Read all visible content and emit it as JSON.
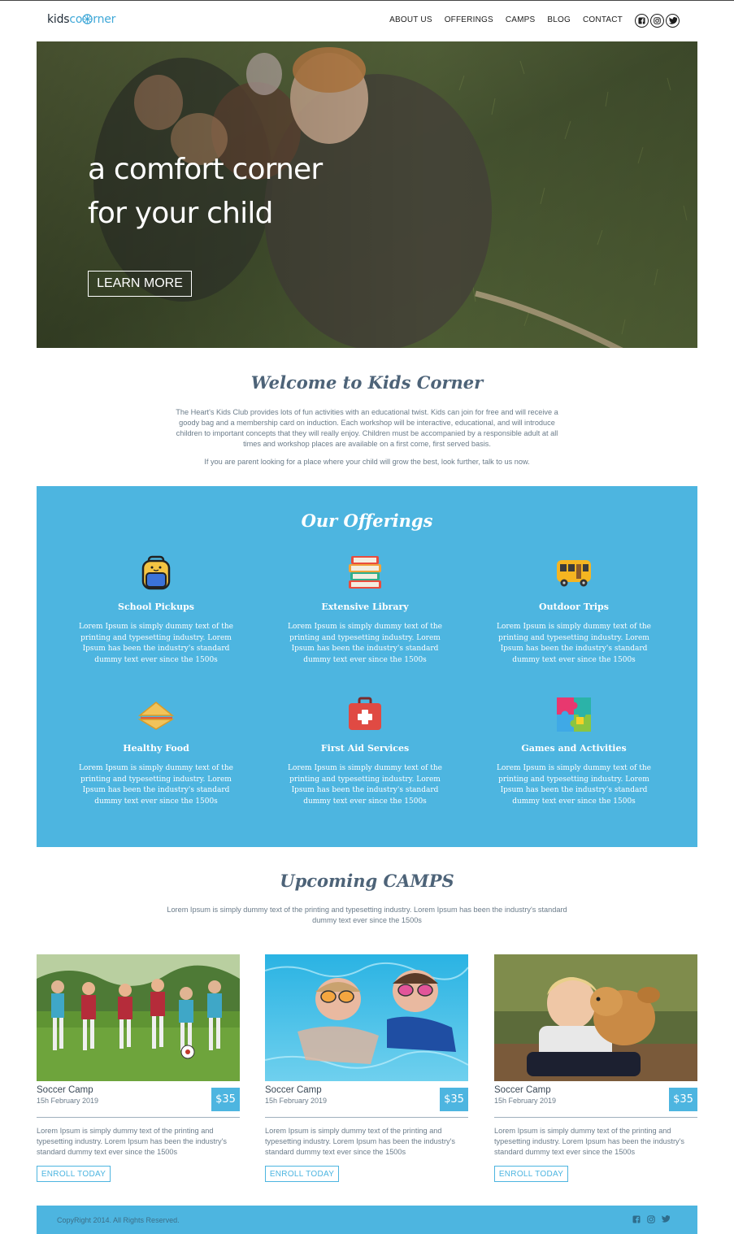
{
  "header": {
    "logo_prefix": "kids",
    "logo_accent": "rner",
    "nav": [
      "ABOUT US",
      "OFFERINGS",
      "CAMPS",
      "BLOG",
      "CONTACT"
    ],
    "social": [
      "facebook-icon",
      "instagram-icon",
      "twitter-icon"
    ]
  },
  "hero": {
    "line1": "a comfort corner",
    "line2": "for your child",
    "cta": "LEARN MORE"
  },
  "welcome": {
    "title": "Welcome to Kids Corner",
    "paragraph": "The Heart's Kids Club provides lots of fun activities with an educational twist. Kids can join for free and will receive a goody bag and a membership card on induction. Each workshop will be interactive, educational, and will introduce children to important concepts that they will really enjoy. Children must be accompanied by a responsible adult at all times and workshop places are available on a first come, first served basis.",
    "paragraph2": "If you are parent looking for a place where your child will grow the best, look further, talk to us now."
  },
  "offerings": {
    "title": "Our Offerings",
    "items": [
      {
        "title": "School Pickups",
        "icon": "backpack-icon",
        "text": "Lorem Ipsum is simply dummy text of the printing and typesetting industry. Lorem Ipsum has been the industry's standard dummy text ever since the 1500s"
      },
      {
        "title": "Extensive Library",
        "icon": "books-icon",
        "text": "Lorem Ipsum is simply dummy text of the printing and typesetting industry. Lorem Ipsum has been the industry's standard dummy text ever since the 1500s"
      },
      {
        "title": "Outdoor Trips",
        "icon": "bus-icon",
        "text": "Lorem Ipsum is simply dummy text of the printing and typesetting industry. Lorem Ipsum has been the industry's standard dummy text ever since the 1500s"
      },
      {
        "title": "Healthy Food",
        "icon": "sandwich-icon",
        "text": "Lorem Ipsum is simply dummy text of the printing and typesetting industry. Lorem Ipsum has been the industry's standard dummy text ever since the 1500s"
      },
      {
        "title": "First Aid Services",
        "icon": "first-aid-kit-icon",
        "text": "Lorem Ipsum is simply dummy text of the printing and typesetting industry. Lorem Ipsum has been the industry's standard dummy text ever since the 1500s"
      },
      {
        "title": "Games and Activities",
        "icon": "puzzle-icon",
        "text": "Lorem Ipsum is simply dummy text of the printing and typesetting industry. Lorem Ipsum has been the industry's standard dummy text ever since the 1500s"
      }
    ]
  },
  "camps": {
    "title": "Upcoming CAMPS",
    "intro": "Lorem Ipsum is simply dummy text of the printing and typesetting industry. Lorem Ipsum has been the industry's standard dummy text ever since the 1500s",
    "items": [
      {
        "name": "Soccer Camp",
        "date": "15h February 2019",
        "price": "$35",
        "desc": "Lorem Ipsum is simply dummy text of the printing and typesetting industry. Lorem Ipsum has been the industry's standard dummy text ever since the 1500s",
        "cta": "ENROLL TODAY"
      },
      {
        "name": "Soccer Camp",
        "date": "15h February 2019",
        "price": "$35",
        "desc": "Lorem Ipsum is simply dummy text of the printing and typesetting industry. Lorem Ipsum has been the industry's standard dummy text ever since the 1500s",
        "cta": "ENROLL TODAY"
      },
      {
        "name": "Soccer Camp",
        "date": "15h February 2019",
        "price": "$35",
        "desc": "Lorem Ipsum is simply dummy text of the printing and typesetting industry. Lorem Ipsum has been the industry's standard dummy text ever since the 1500s",
        "cta": "ENROLL TODAY"
      }
    ]
  },
  "footer": {
    "copyright": "CopyRight 2014. All Rights Reserved.",
    "social": [
      "facebook-icon",
      "instagram-icon",
      "twitter-icon"
    ]
  },
  "colors": {
    "accent": "#4db5e0",
    "heading": "#4d6378",
    "text": "#6b7c8a"
  }
}
